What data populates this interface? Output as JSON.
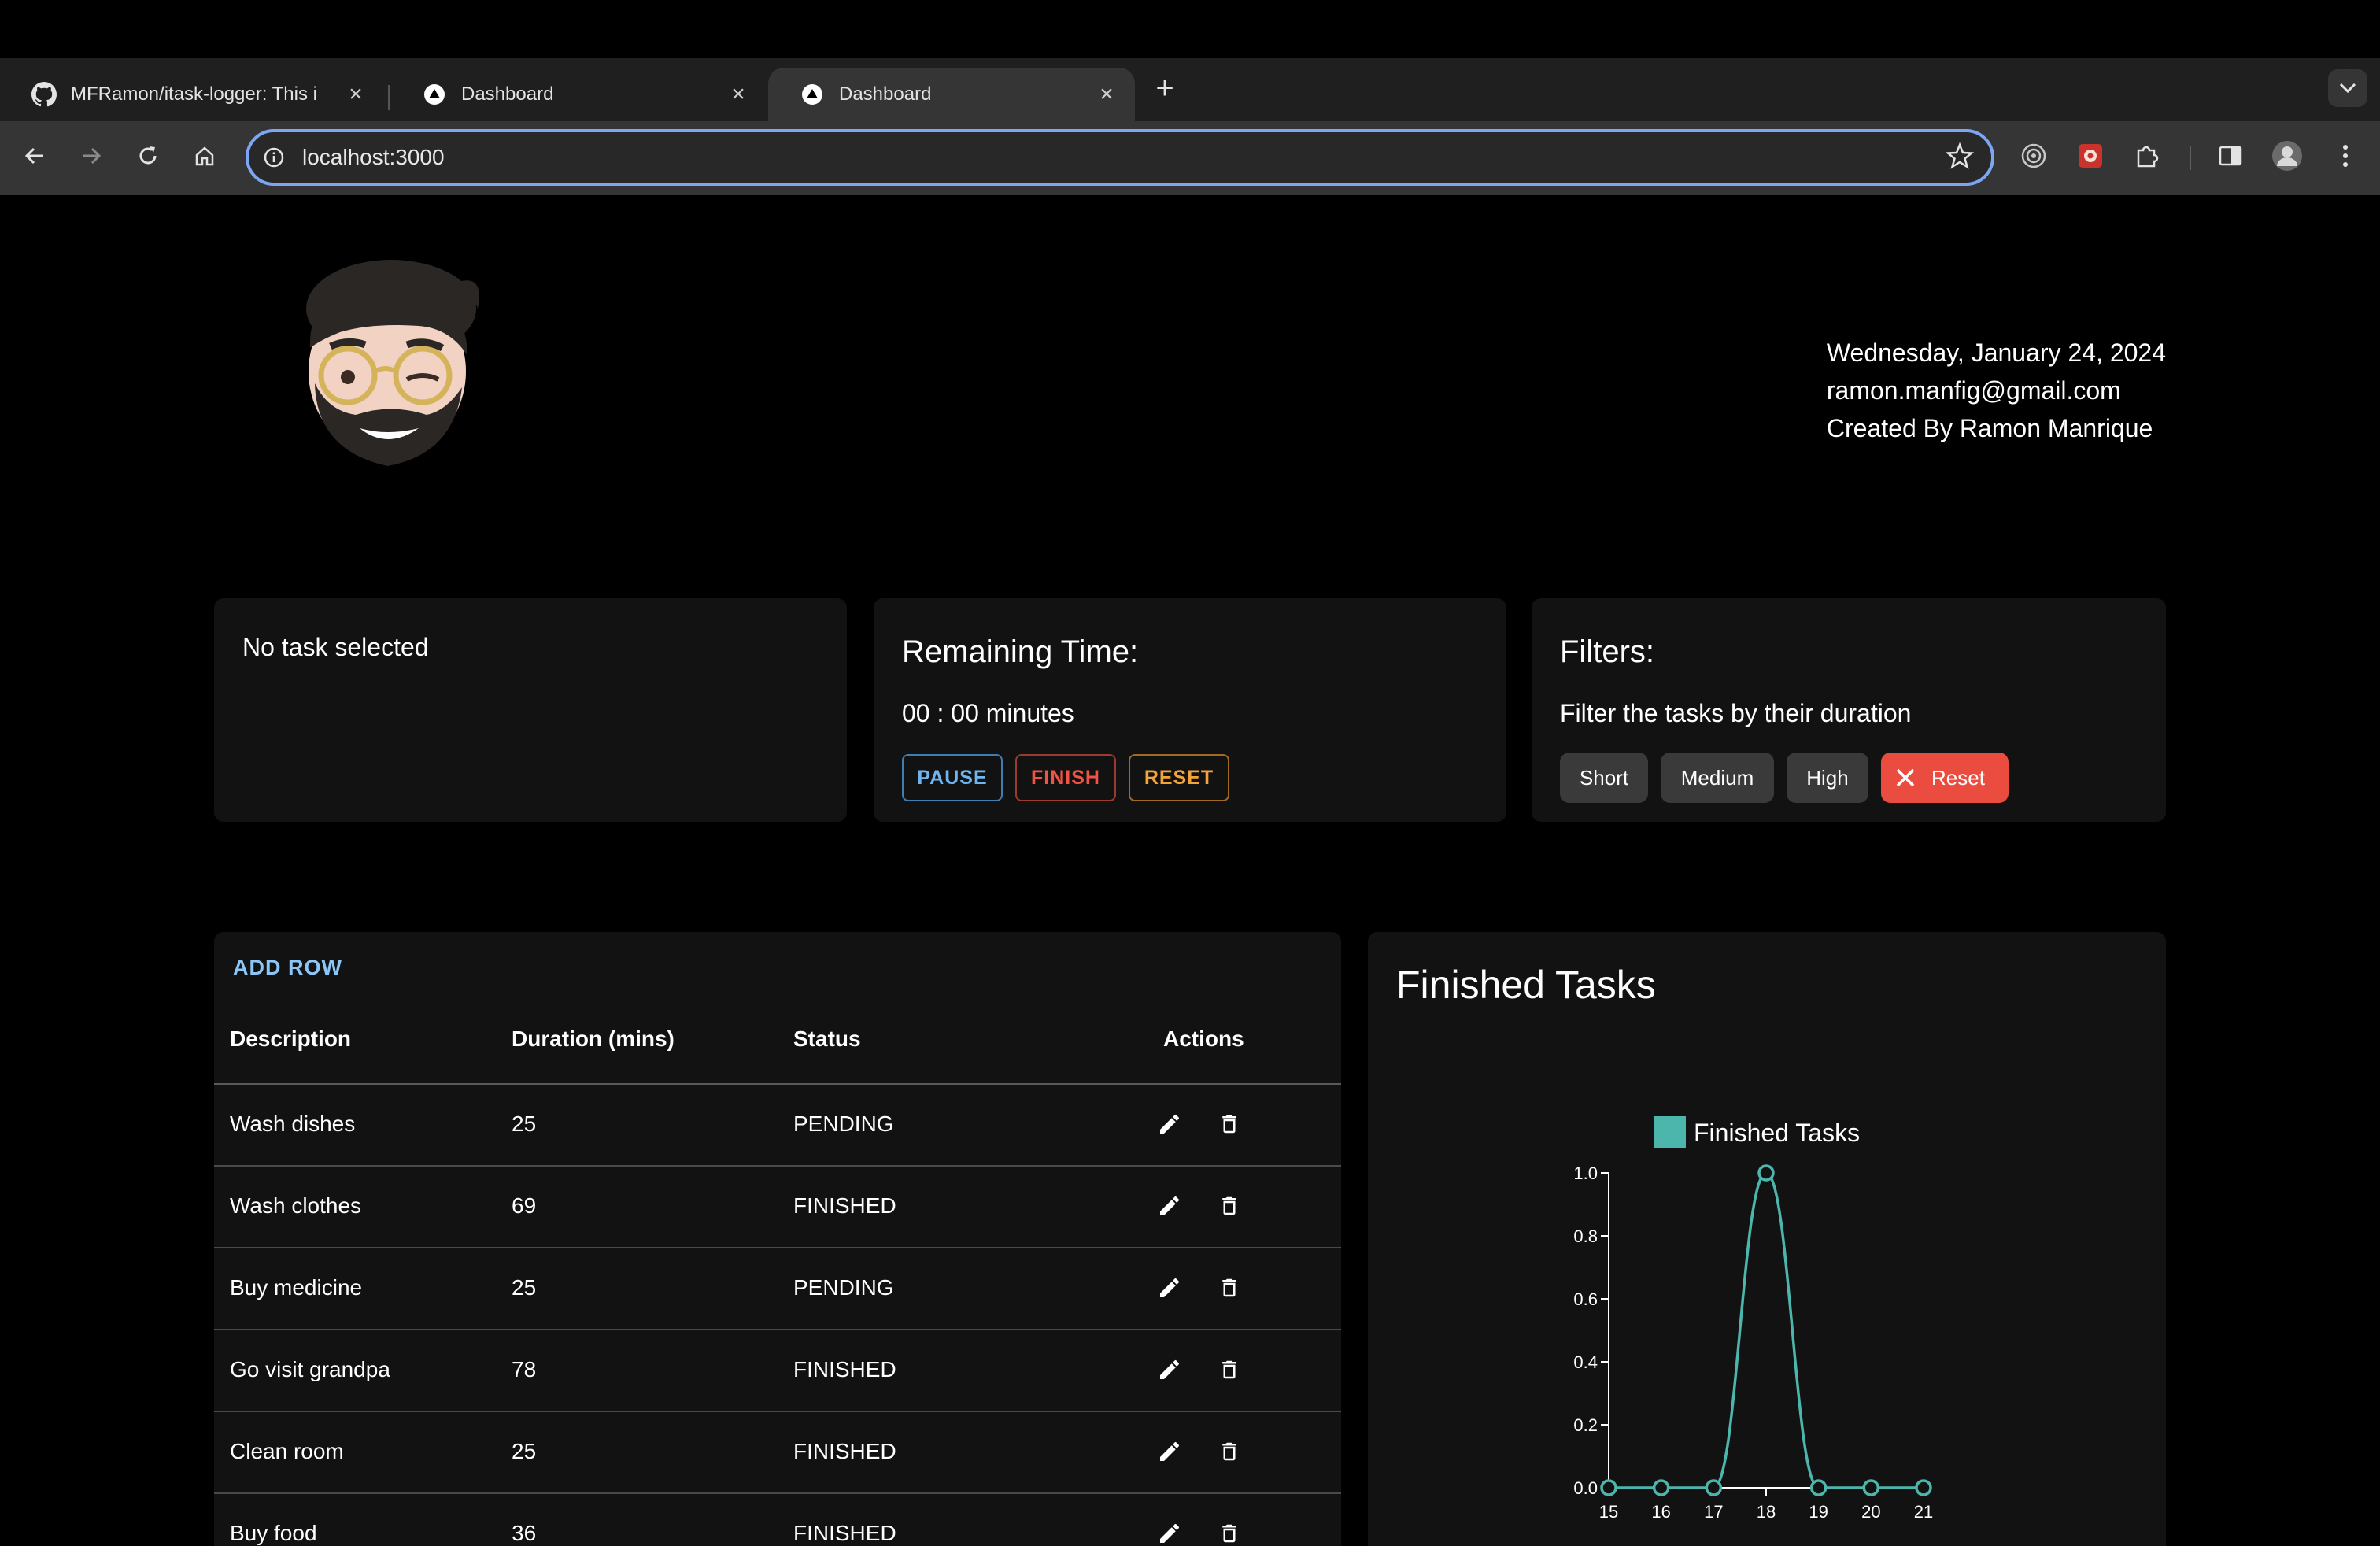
{
  "browser": {
    "tabs": [
      {
        "title": "MFRamon/itask-logger: This i",
        "icon": "github-icon",
        "active": false
      },
      {
        "title": "Dashboard",
        "icon": "nextjs-icon",
        "active": false
      },
      {
        "title": "Dashboard",
        "icon": "nextjs-icon",
        "active": true
      }
    ],
    "url": "localhost:3000"
  },
  "header": {
    "date": "Wednesday, January 24, 2024",
    "email": "ramon.manfig@gmail.com",
    "credit": "Created By Ramon Manrique"
  },
  "task_panel": {
    "message": "No task selected"
  },
  "timer": {
    "title": "Remaining Time:",
    "time": "00 : 00 minutes",
    "pause_label": "PAUSE",
    "finish_label": "FINISH",
    "reset_label": "RESET"
  },
  "filters": {
    "title": "Filters:",
    "subtitle": "Filter the tasks by their duration",
    "short_label": "Short",
    "medium_label": "Medium",
    "high_label": "High",
    "reset_label": "Reset"
  },
  "table": {
    "add_row_label": "ADD ROW",
    "headers": {
      "description": "Description",
      "duration": "Duration (mins)",
      "status": "Status",
      "actions": "Actions"
    },
    "rows": [
      {
        "description": "Wash dishes",
        "duration": "25",
        "status": "PENDING"
      },
      {
        "description": "Wash clothes",
        "duration": "69",
        "status": "FINISHED"
      },
      {
        "description": "Buy medicine",
        "duration": "25",
        "status": "PENDING"
      },
      {
        "description": "Go visit grandpa",
        "duration": "78",
        "status": "FINISHED"
      },
      {
        "description": "Clean room",
        "duration": "25",
        "status": "FINISHED"
      },
      {
        "description": "Buy food",
        "duration": "36",
        "status": "FINISHED"
      }
    ]
  },
  "chart_data": {
    "type": "line",
    "title": "Finished Tasks",
    "x": [
      15,
      16,
      17,
      18,
      19,
      20,
      21
    ],
    "series": [
      {
        "name": "Finished Tasks",
        "values": [
          0,
          0,
          0,
          1,
          0,
          0,
          0
        ],
        "color": "#4db6ac"
      }
    ],
    "yticks": [
      "0.0",
      "0.2",
      "0.4",
      "0.6",
      "0.8",
      "1.0"
    ],
    "ylim": [
      0,
      1
    ],
    "legend": "top",
    "grid": false
  }
}
